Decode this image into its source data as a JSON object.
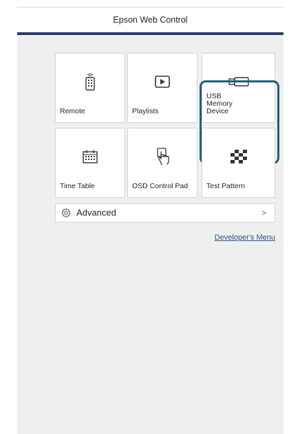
{
  "header": {
    "title": "Epson Web Control"
  },
  "tiles": [
    {
      "label": "Remote",
      "icon": "remote-icon"
    },
    {
      "label": "Playlists",
      "icon": "playlist-icon"
    },
    {
      "label": "USB Memory Device",
      "icon": "usb-icon",
      "selected": true
    },
    {
      "label": "Time Table",
      "icon": "calendar-icon"
    },
    {
      "label": "OSD Control Pad",
      "icon": "touch-hand-icon"
    },
    {
      "label": "Test Pattern",
      "icon": "checkerboard-icon"
    }
  ],
  "advanced": {
    "label": "Advanced",
    "icon": "gear-icon",
    "chevron": ">"
  },
  "developer_link": "Developer's Menu",
  "colors": {
    "header_bar": "#2a3a6b",
    "selection": "#1f5e7e",
    "link": "#2a4f86"
  }
}
